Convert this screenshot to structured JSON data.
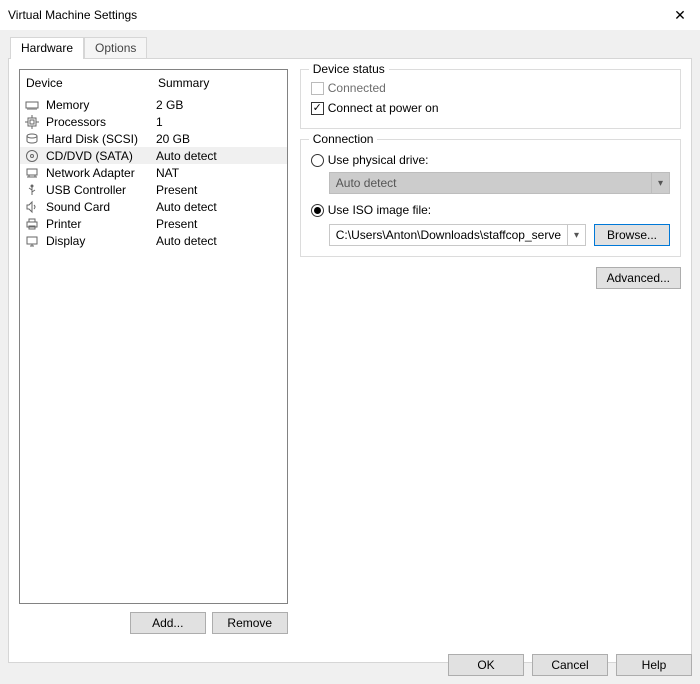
{
  "window": {
    "title": "Virtual Machine Settings"
  },
  "tabs": {
    "hardware": "Hardware",
    "options": "Options"
  },
  "device_list": {
    "header_device": "Device",
    "header_summary": "Summary",
    "rows": [
      {
        "icon": "memory-icon",
        "device": "Memory",
        "summary": "2 GB"
      },
      {
        "icon": "cpu-icon",
        "device": "Processors",
        "summary": "1"
      },
      {
        "icon": "hdd-icon",
        "device": "Hard Disk (SCSI)",
        "summary": "20 GB"
      },
      {
        "icon": "cd-icon",
        "device": "CD/DVD (SATA)",
        "summary": "Auto detect"
      },
      {
        "icon": "net-icon",
        "device": "Network Adapter",
        "summary": "NAT"
      },
      {
        "icon": "usb-icon",
        "device": "USB Controller",
        "summary": "Present"
      },
      {
        "icon": "sound-icon",
        "device": "Sound Card",
        "summary": "Auto detect"
      },
      {
        "icon": "printer-icon",
        "device": "Printer",
        "summary": "Present"
      },
      {
        "icon": "display-icon",
        "device": "Display",
        "summary": "Auto detect"
      }
    ],
    "selected_index": 3
  },
  "buttons": {
    "add": "Add...",
    "remove": "Remove",
    "ok": "OK",
    "cancel": "Cancel",
    "help": "Help",
    "advanced": "Advanced...",
    "browse": "Browse..."
  },
  "device_status": {
    "legend": "Device status",
    "connected_label": "Connected",
    "connected_checked": false,
    "connected_enabled": false,
    "power_on_label": "Connect at power on",
    "power_on_checked": true
  },
  "connection": {
    "legend": "Connection",
    "physical_label": "Use physical drive:",
    "physical_value": "Auto detect",
    "iso_label": "Use ISO image file:",
    "iso_value": "C:\\Users\\Anton\\Downloads\\staffcop_serve",
    "selected": "iso"
  }
}
